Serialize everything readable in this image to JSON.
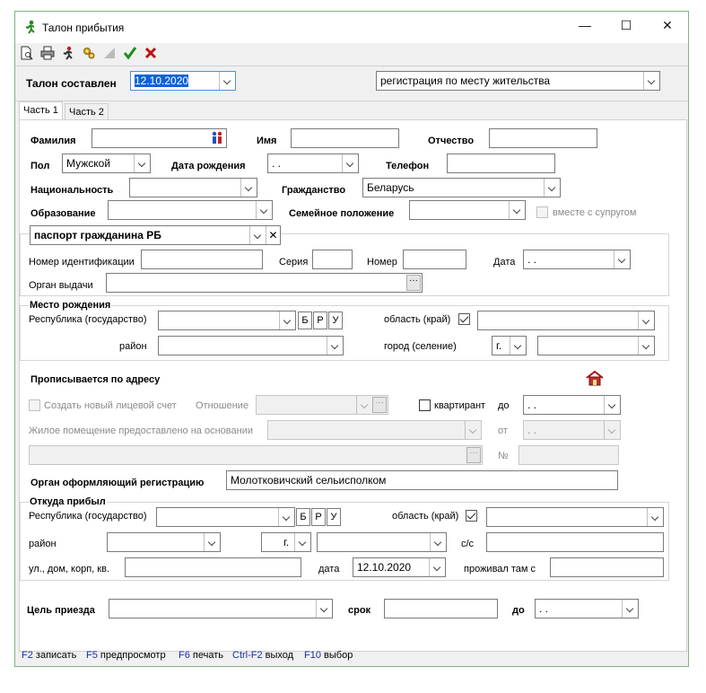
{
  "window": {
    "title": "Талон прибытия",
    "minimize": "—",
    "maximize": "☐",
    "close": "✕"
  },
  "toolbar": {
    "icons": [
      "preview-icon",
      "print-icon",
      "person-run-icon",
      "gears-icon",
      "blank-icon",
      "check-icon",
      "cross-icon"
    ],
    "check_color": "#1a8f1a",
    "cross_color": "#c01010"
  },
  "header": {
    "label": "Талон составлен",
    "date": "12.10.2020",
    "reg_type": "регистрация по месту жительства"
  },
  "tabs": [
    "Часть 1",
    "Часть 2"
  ],
  "person": {
    "surname_label": "Фамилия",
    "name_label": "Имя",
    "patronymic_label": "Отчество",
    "sex_label": "Пол",
    "sex_value": "Мужской",
    "birth_label": "Дата рождения",
    "birth_value": " .  .",
    "phone_label": "Телефон",
    "nationality_label": "Национальность",
    "citizenship_label": "Гражданство",
    "citizenship_value": "Беларусь",
    "education_label": "Образование",
    "marital_label": "Семейное положение",
    "with_spouse_label": "вместе с супругом"
  },
  "document": {
    "type": "паспорт гражданина РБ",
    "clear": "✕",
    "idnum_label": "Номер идентификации",
    "series_label": "Серия",
    "number_label": "Номер",
    "date_label": "Дата",
    "date_value": " .  .",
    "issuer_label": "Орган выдачи",
    "dots": "···"
  },
  "birthplace": {
    "title": "Место рождения",
    "country_label": "Республика (государство)",
    "btn_b": "Б",
    "btn_r": "Р",
    "btn_u": "У",
    "region_label": "область (край)",
    "district_label": "район",
    "city_label": "город (селение)",
    "city_type": "г."
  },
  "address": {
    "title": "Прописывается по адресу",
    "new_account_label": "Создать новый лицевой счет",
    "relation_label": "Отношение",
    "lodger_label": "квартирант",
    "until_label": "до",
    "until_value": " .  .",
    "basis_label": "Жилое помещение предоставлено на основании",
    "from_label": "от",
    "from_value": " .  .",
    "no_label": "№",
    "dots": "···"
  },
  "authority": {
    "label": "Орган оформляющий регистрацию",
    "value": "Молотковичский сельисполком"
  },
  "origin": {
    "title": "Откуда прибыл",
    "country_label": "Республика (государство)",
    "btn_b": "Б",
    "btn_r": "Р",
    "btn_u": "У",
    "region_label": "область (край)",
    "district_label": "район",
    "city_type": "г.",
    "ss_label": "с/с",
    "street_label": "ул., дом, корп, кв.",
    "date_label": "дата",
    "date_value": "12.10.2020",
    "lived_label": "проживал там с"
  },
  "purpose": {
    "label": "Цель приезда",
    "term_label": "срок",
    "until_label": "до",
    "until_value": " .  ."
  },
  "statusbar": {
    "items": [
      {
        "key": "F2",
        "text": "записать"
      },
      {
        "key": "F5",
        "text": "предпросмотр"
      },
      {
        "key": "F6",
        "text": "печать"
      },
      {
        "key": "Ctrl-F2",
        "text": "выход"
      },
      {
        "key": "F10",
        "text": "выбор"
      }
    ]
  }
}
